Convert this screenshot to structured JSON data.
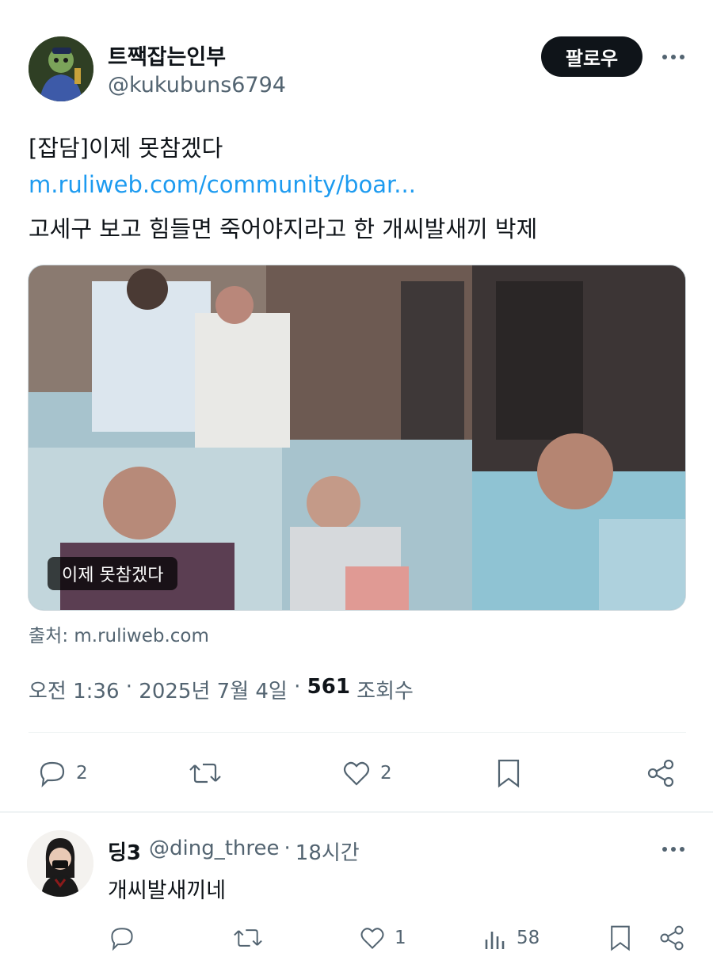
{
  "tweet": {
    "display_name": "트짹잡는인부",
    "handle": "@kukubuns6794",
    "follow_label": "팔로우",
    "text_line1": "[잡담]이제 못참겠다",
    "link_text": "m.ruliweb.com/community/boar...",
    "text_line3": "고세구 보고 힘들면 죽어야지라고 한 개씨발새끼 박제",
    "media_caption": "이제 못참겠다",
    "source": "출처: m.ruliweb.com",
    "meta": {
      "time": "오전 1:36",
      "sep1": " · ",
      "date": "2025년 7월 4일",
      "sep2": " · ",
      "views": "561",
      "views_label": " 조회수"
    },
    "actions": {
      "reply_count": "2",
      "retweet_count": "",
      "like_count": "2"
    }
  },
  "reply": {
    "name": "딩3",
    "handle": "@ding_three",
    "dot": "·",
    "time": "18시간",
    "text": "개씨발새끼네",
    "actions": {
      "reply_count": "",
      "retweet_count": "",
      "like_count": "1",
      "views_count": "58"
    }
  },
  "colors": {
    "text": "#0f1419",
    "secondary": "#536471",
    "link": "#1d9bf0",
    "button": "#0f1419"
  }
}
